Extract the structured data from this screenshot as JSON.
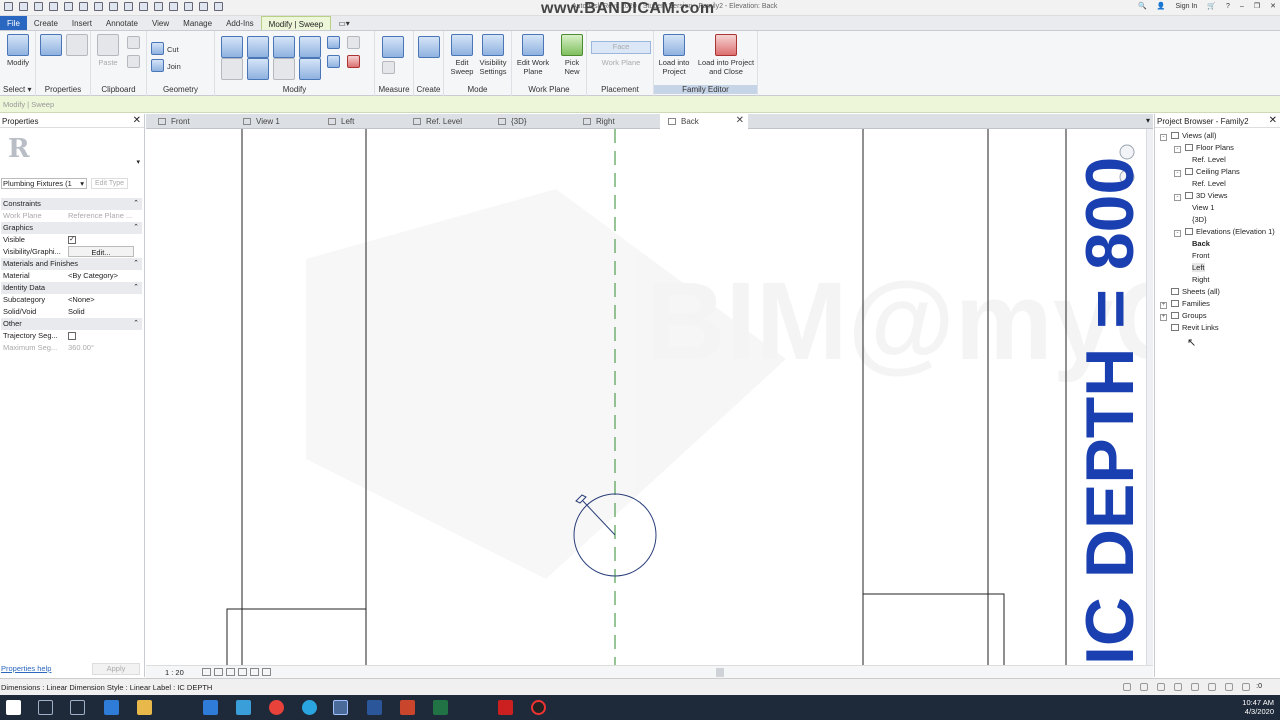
{
  "titlebar": {
    "title": "Autodesk Revit 2020 - Student Version - Family2 - Elevation: Back",
    "recorder_watermark": "www.BANDICAM.com",
    "sign_in": "Sign In",
    "help": "?"
  },
  "ribbon_tabs": [
    "File",
    "Create",
    "Insert",
    "Annotate",
    "View",
    "Manage",
    "Add-Ins",
    "Modify | Sweep"
  ],
  "ribbon": {
    "modify": "Modify",
    "select": "Select",
    "properties": "Properties",
    "clipboard": "Clipboard",
    "paste": "Paste",
    "cut": "Cut",
    "join": "Join",
    "geometry": "Geometry",
    "modify_panel": "Modify",
    "measure": "Measure",
    "create": "Create",
    "mode": "Mode",
    "work_plane": "Work Plane",
    "placement": "Placement",
    "family_editor": "Family Editor",
    "edit_sweep": "Edit Sweep",
    "visibility_settings": "Visibility Settings",
    "edit_work_plane": "Edit Work Plane",
    "pick_new": "Pick New",
    "face": "Face",
    "work_plane_btn": "Work Plane",
    "load_into_project": "Load into Project",
    "load_into_project_close": "Load into Project and Close"
  },
  "options_bar": "Modify | Sweep",
  "properties": {
    "title": "Properties",
    "type_selector": "Plumbing Fixtures (1",
    "edit_type": "Edit Type",
    "rows": [
      {
        "kind": "cat",
        "label": "Constraints"
      },
      {
        "kind": "row",
        "label": "Work Plane",
        "value": "Reference Plane ...",
        "dim": true
      },
      {
        "kind": "cat",
        "label": "Graphics"
      },
      {
        "kind": "check",
        "label": "Visible",
        "checked": true
      },
      {
        "kind": "button",
        "label": "Visibility/Graphi...",
        "value": "Edit..."
      },
      {
        "kind": "cat",
        "label": "Materials and Finishes"
      },
      {
        "kind": "row",
        "label": "Material",
        "value": "<By Category>"
      },
      {
        "kind": "cat",
        "label": "Identity Data"
      },
      {
        "kind": "row",
        "label": "Subcategory",
        "value": "<None>"
      },
      {
        "kind": "row",
        "label": "Solid/Void",
        "value": "Solid"
      },
      {
        "kind": "cat",
        "label": "Other"
      },
      {
        "kind": "check",
        "label": "Trajectory Seg...",
        "checked": false
      },
      {
        "kind": "row",
        "label": "Maximum Seg...",
        "value": "360.00°",
        "dim": true
      }
    ],
    "help": "Properties help",
    "apply": "Apply"
  },
  "view_tabs": [
    {
      "label": "Front",
      "active": false
    },
    {
      "label": "View 1",
      "active": false
    },
    {
      "label": "Left",
      "active": false
    },
    {
      "label": "Ref. Level",
      "active": false
    },
    {
      "label": "{3D}",
      "active": false
    },
    {
      "label": "Right",
      "active": false
    },
    {
      "label": "Back",
      "active": true
    }
  ],
  "canvas": {
    "dimension_label": "IC DEPTH = 800",
    "dimension_color": "#1a3fb0",
    "watermark": "BIM@myCC"
  },
  "view_control": {
    "scale": "1 : 20"
  },
  "project_browser": {
    "title": "Project Browser - Family2",
    "nodes": [
      {
        "label": "Views (all)",
        "level": 0,
        "toggle": "-"
      },
      {
        "label": "Floor Plans",
        "level": 1,
        "toggle": "-"
      },
      {
        "label": "Ref. Level",
        "level": 2
      },
      {
        "label": "Ceiling Plans",
        "level": 1,
        "toggle": "-"
      },
      {
        "label": "Ref. Level",
        "level": 2
      },
      {
        "label": "3D Views",
        "level": 1,
        "toggle": "-"
      },
      {
        "label": "View 1",
        "level": 2
      },
      {
        "label": "{3D}",
        "level": 2
      },
      {
        "label": "Elevations (Elevation 1)",
        "level": 1,
        "toggle": "-"
      },
      {
        "label": "Back",
        "level": 2,
        "bold": true
      },
      {
        "label": "Front",
        "level": 2
      },
      {
        "label": "Left",
        "level": 2,
        "highlight": true
      },
      {
        "label": "Right",
        "level": 2
      },
      {
        "label": "Sheets (all)",
        "level": 0
      },
      {
        "label": "Families",
        "level": 0,
        "toggle": "+"
      },
      {
        "label": "Groups",
        "level": 0,
        "toggle": "+"
      },
      {
        "label": "Revit Links",
        "level": 0
      }
    ]
  },
  "status": {
    "text": "Dimensions : Linear Dimension Style : Linear  Label : IC DEPTH",
    "filter_count": ":0"
  },
  "taskbar": {
    "time": "10:47 AM",
    "date": "4/3/2020"
  }
}
